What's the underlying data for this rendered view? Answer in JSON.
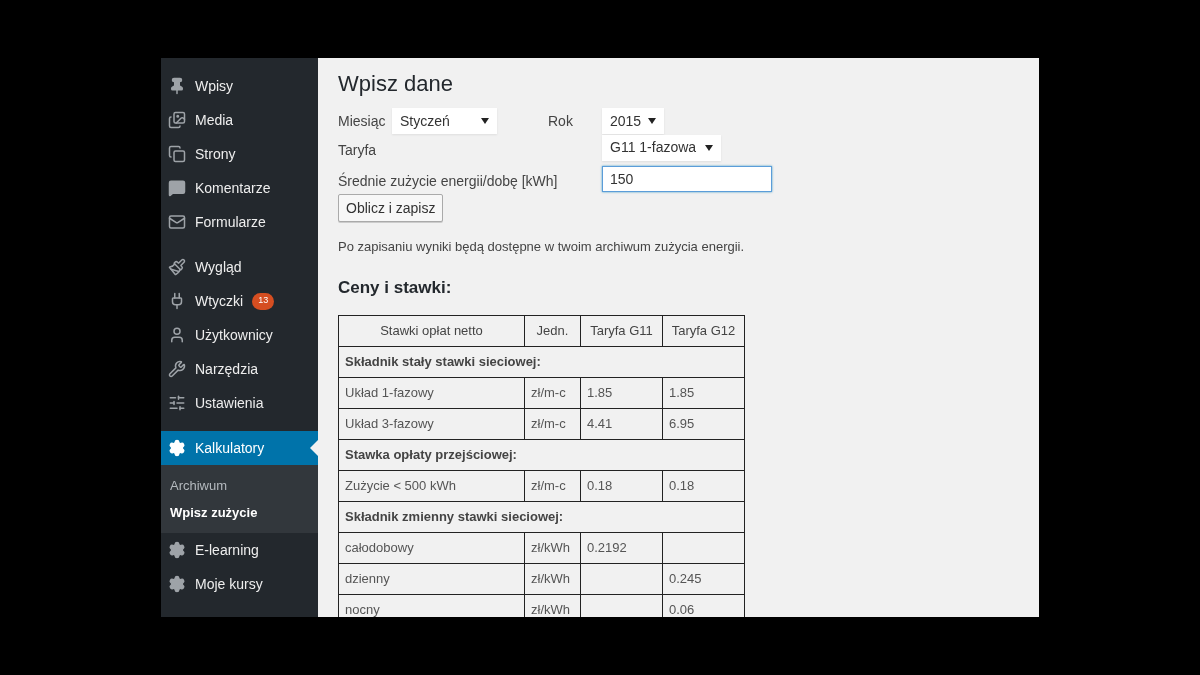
{
  "sidebar": {
    "groups": [
      [
        {
          "label": "Wpisy",
          "selected": false
        },
        {
          "label": "Media",
          "selected": false
        },
        {
          "label": "Strony",
          "selected": false
        },
        {
          "label": "Komentarze",
          "selected": false
        },
        {
          "label": "Formularze",
          "selected": false
        }
      ],
      [
        {
          "label": "Wygląd",
          "selected": false
        },
        {
          "label": "Wtyczki",
          "badge": "13",
          "selected": false
        },
        {
          "label": "Użytkownicy",
          "selected": false
        },
        {
          "label": "Narzędzia",
          "selected": false
        },
        {
          "label": "Ustawienia",
          "selected": false
        }
      ],
      [
        {
          "label": "Kalkulatory",
          "selected": true,
          "children": [
            {
              "label": "Archiwum",
              "selected": false
            },
            {
              "label": "Wpisz zużycie",
              "selected": true
            }
          ]
        },
        {
          "label": "E-learning",
          "selected": false
        },
        {
          "label": "Moje kursy",
          "selected": false
        }
      ]
    ]
  },
  "form": {
    "title": "Wpisz dane",
    "month": {
      "label": "Miesiąc",
      "value": "Styczeń"
    },
    "year": {
      "label": "Rok",
      "value": "2015"
    },
    "tariff": {
      "label": "Taryfa",
      "value": "G11 1-fazowa"
    },
    "usage": {
      "label": "Średnie zużycie energii/dobę [kWh]",
      "value": "150",
      "focused": true
    },
    "submit": "Oblicz i zapisz",
    "note": "Po zapisaniu wyniki będą dostępne w twoim archiwum zużycia energii."
  },
  "rates": {
    "title": "Ceny i stawki:",
    "columns": [
      "Stawki opłat netto",
      "Jedn.",
      "Taryfa G11",
      "Taryfa G12"
    ],
    "rows": [
      {
        "kind": "section",
        "label": "Składnik stały stawki sieciowej:"
      },
      {
        "kind": "data",
        "cells": [
          "Układ 1-fazowy",
          "zł/m-c",
          "1.85",
          "1.85"
        ]
      },
      {
        "kind": "data",
        "cells": [
          "Układ 3-fazowy",
          "zł/m-c",
          "4.41",
          "6.95"
        ]
      },
      {
        "kind": "section",
        "label": "Stawka opłaty przejściowej:"
      },
      {
        "kind": "data",
        "cells": [
          "Zużycie < 500 kWh",
          "zł/m-c",
          "0.18",
          "0.18"
        ]
      },
      {
        "kind": "section",
        "label": "Składnik zmienny stawki sieciowej:"
      },
      {
        "kind": "data",
        "cells": [
          "całodobowy",
          "zł/kWh",
          "0.2192",
          null
        ]
      },
      {
        "kind": "data",
        "cells": [
          "dzienny",
          "zł/kWh",
          null,
          "0.245"
        ]
      },
      {
        "kind": "data",
        "cells": [
          "nocny",
          "zł/kWh",
          null,
          "0.06"
        ]
      }
    ]
  }
}
